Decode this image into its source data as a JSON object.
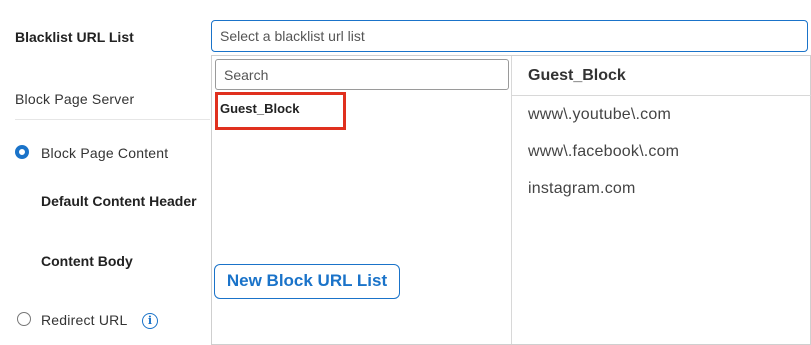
{
  "form": {
    "blacklist_label": "Blacklist URL List",
    "block_page_server_label": "Block Page Server",
    "block_page_content_label": "Block Page Content",
    "default_content_header_label": "Default Content Header",
    "content_body_label": "Content Body",
    "redirect_url_label": "Redirect URL",
    "info_icon_glyph": "i"
  },
  "select": {
    "placeholder": "Select a blacklist url list"
  },
  "dropdown": {
    "search_placeholder": "Search",
    "lists": [
      {
        "label": "Guest_Block",
        "selected": true
      }
    ],
    "new_button_label": "New Block URL List",
    "preview": {
      "title": "Guest_Block",
      "entries": [
        "www\\.youtube\\.com",
        "www\\.facebook\\.com",
        "instagram.com"
      ]
    }
  },
  "colors": {
    "accent": "#1a73c9",
    "highlight": "#e0301e"
  },
  "icons": [
    "radio-checked-icon",
    "radio-unchecked-icon",
    "info-icon"
  ]
}
